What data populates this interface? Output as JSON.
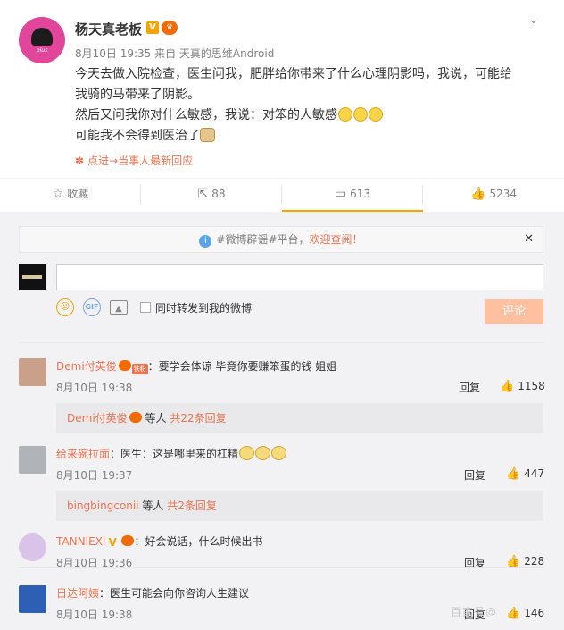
{
  "post": {
    "author": "杨天真老板",
    "avatar_text": "plus",
    "meta": "8月10日 19:35 来自 天真的思维Android",
    "lines": [
      "今天去做入院检查，医生问我，肥胖给你带来了什么心理阴影吗，我说，可能给",
      "我骑的马带来了阴影。",
      "然后又问我你对什么敏感，我说：对笨的人敏感",
      "可能我不会得到医治了"
    ],
    "hint": "点进→当事人最新回应"
  },
  "actions": {
    "favorite": "收藏",
    "repost": "88",
    "comment": "613",
    "like": "5234"
  },
  "notice": {
    "tag": "#微博辟谣#平台，",
    "link": "欢迎查阅！"
  },
  "composer": {
    "sync_label": "同时转发到我的微博",
    "submit": "评论"
  },
  "comments": [
    {
      "nick": "Demi付英俊",
      "fans": "铁粉",
      "text": "：要学会体谅 毕竟你要赚笨蛋的钱 姐姐",
      "time": "8月10日 19:38",
      "reply": "回复",
      "likes": "1158",
      "sub_nick": "Demi付英俊",
      "sub_text": "等人",
      "sub_more": "共22条回复"
    },
    {
      "nick": "给来碗拉面",
      "text": "：医生：这是哪里来的杠精",
      "time": "8月10日 19:37",
      "reply": "回复",
      "likes": "447",
      "sub_nick": "bingbingconii",
      "sub_text": "等人",
      "sub_more": "共2条回复"
    },
    {
      "nick": "TANNIEXI",
      "text": "：好会说话，什么时候出书",
      "time": "8月10日 19:36",
      "reply": "回复",
      "likes": "228"
    },
    {
      "nick": "日达阿姨",
      "text": "：医生可能会向你咨询人生建议",
      "time": "8月10日 19:38",
      "reply": "回复",
      "likes": "146"
    }
  ],
  "watermark": "百家号@"
}
